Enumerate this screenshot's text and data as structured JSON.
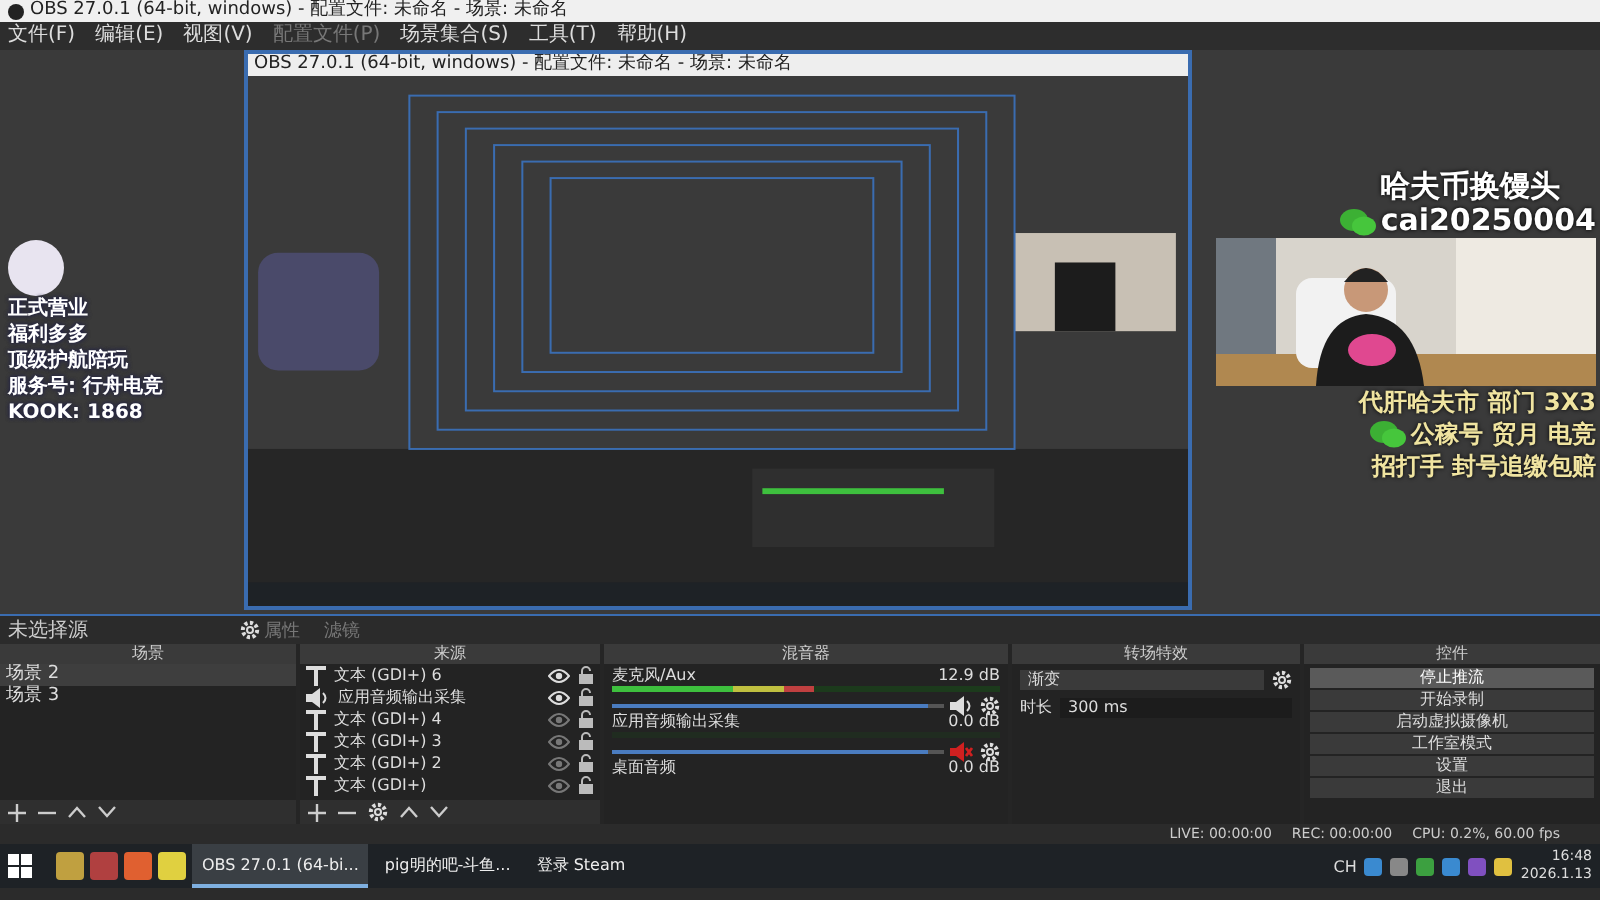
{
  "window": {
    "title": "OBS 27.0.1 (64-bit, windows) - 配置文件: 未命名 - 场景: 未命名"
  },
  "menu": [
    {
      "label": "文件(F)",
      "disabled": false
    },
    {
      "label": "编辑(E)",
      "disabled": false
    },
    {
      "label": "视图(V)",
      "disabled": false
    },
    {
      "label": "配置文件(P)",
      "disabled": true
    },
    {
      "label": "场景集合(S)",
      "disabled": false
    },
    {
      "label": "工具(T)",
      "disabled": false
    },
    {
      "label": "帮助(H)",
      "disabled": false
    }
  ],
  "preview": {
    "left_overlay": {
      "lines": [
        "正式营业",
        "福利多多",
        "顶级护航陪玩",
        "服务号: 行舟电竞",
        "KOOK: 1868"
      ]
    },
    "nested_capture": {
      "title": "OBS 27.0.1 (64-bit, windows) - 配置文件: 未命名 - 场景: 未命名"
    },
    "right_overlay": {
      "heading": "哈夫币换馒头",
      "contact": "cai20250004",
      "lines": [
        "代肝哈夫市 部门 3X3",
        "公稼号 贸月 电竞",
        "招打手 封号追缴包赔"
      ]
    }
  },
  "source_toolbar": {
    "label": "未选择源",
    "buttons": [
      {
        "label": "属性",
        "disabled": true
      },
      {
        "label": "滤镜",
        "disabled": true
      }
    ]
  },
  "scenes": {
    "title": "场景",
    "items": [
      {
        "label": "场景 2",
        "selected": true
      },
      {
        "label": "场景 3",
        "selected": false
      }
    ]
  },
  "sources": {
    "title": "来源",
    "items": [
      {
        "kind": "text",
        "label": "文本 (GDI+) 6",
        "visible": true
      },
      {
        "kind": "audio",
        "label": "应用音频输出采集",
        "visible": true
      },
      {
        "kind": "text",
        "label": "文本 (GDI+) 4",
        "visible": false
      },
      {
        "kind": "text",
        "label": "文本 (GDI+) 3",
        "visible": false
      },
      {
        "kind": "text",
        "label": "文本 (GDI+) 2",
        "visible": false
      },
      {
        "kind": "text",
        "label": "文本 (GDI+)",
        "visible": false
      }
    ]
  },
  "mixer": {
    "title": "混音器",
    "channels": [
      {
        "name": "麦克风/Aux",
        "reading": "12.9 dB",
        "level": 0.52,
        "muted": false,
        "fader": {
          "level": 0.95
        }
      },
      {
        "name": "应用音频输出采集",
        "reading": "0.0 dB",
        "muted": true,
        "fader": {
          "level": 0.95
        }
      },
      {
        "name": "桌面音频",
        "reading": "0.0 dB"
      }
    ]
  },
  "transitions": {
    "title": "转场特效",
    "selected": "渐变",
    "duration_label": "时长",
    "duration": "300 ms"
  },
  "controls": {
    "title": "控件",
    "buttons": [
      {
        "label": "停止推流",
        "active": true
      },
      {
        "label": "开始录制",
        "active": false
      },
      {
        "label": "启动虚拟摄像机",
        "active": false
      },
      {
        "label": "工作室模式",
        "active": false
      },
      {
        "label": "设置",
        "active": false
      },
      {
        "label": "退出",
        "active": false
      }
    ]
  },
  "status_bar": {
    "live": "LIVE: 00:00:00",
    "rec": "REC: 00:00:00",
    "cpu": "CPU: 0.2%, 60.00 fps"
  },
  "taskbar": {
    "windows": [
      {
        "label": "OBS 27.0.1 (64-bi...",
        "selected": true
      },
      {
        "label": "pig明的吧-斗鱼...",
        "selected": false
      },
      {
        "label": "登录 Steam",
        "selected": false
      }
    ],
    "ime": "CH",
    "time": "16:48",
    "date": "2026.1.13"
  }
}
